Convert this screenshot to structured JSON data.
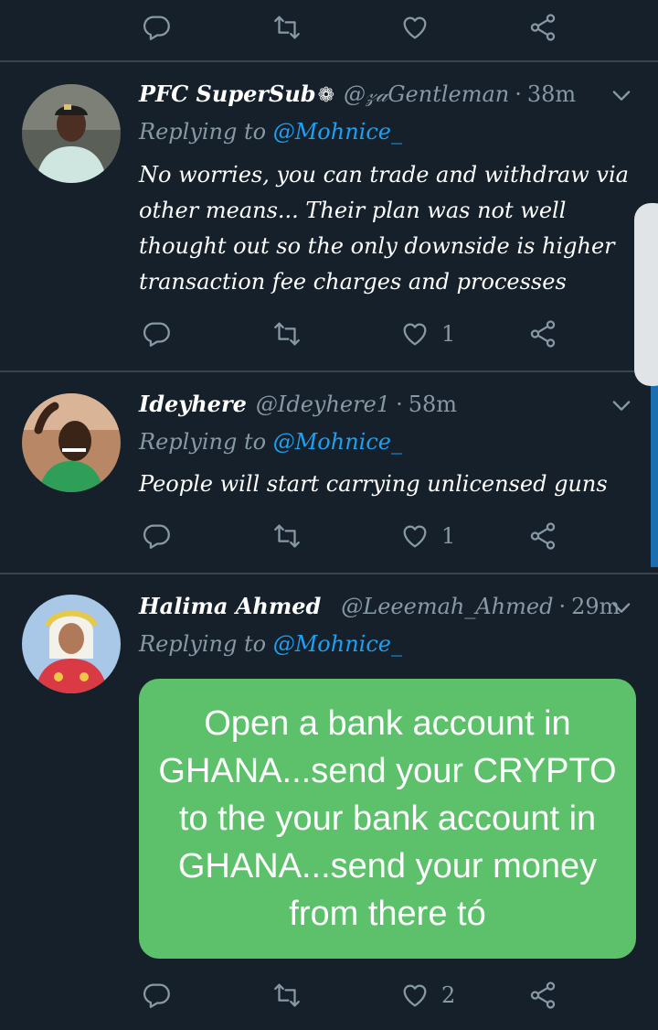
{
  "top_actions": {
    "like_count": ""
  },
  "tweets": [
    {
      "name": "PFC SuperSub",
      "badge": "❁",
      "handle": "@𝓏𝒶Gentleman",
      "time": "38m",
      "replying_prefix": "Replying to",
      "replying_to": "@Mohnice_",
      "text": "No worries, you can trade and withdraw via other means... Their plan was not well thought out so the only downside is higher transaction fee charges and processes",
      "like_count": "1"
    },
    {
      "name": "Ideyhere",
      "handle": "@Ideyhere1",
      "time": "58m",
      "replying_prefix": "Replying to",
      "replying_to": "@Mohnice_",
      "text": "People will start carrying unlicensed guns",
      "like_count": "1"
    },
    {
      "name": "Halima Ahmed",
      "handle": "@Leeemah_Ahmed",
      "time": "29m",
      "replying_prefix": "Replying to",
      "replying_to": "@Mohnice_",
      "media_text": "Open a bank account in GHANA...send your CRYPTO to the your bank account in GHANA...send your money from there tó",
      "like_count": "2"
    }
  ],
  "icons": {
    "reply": "reply-icon",
    "retweet": "retweet-icon",
    "like": "heart-icon",
    "share": "share-icon",
    "menu": "chevron-down-icon"
  },
  "colors": {
    "background": "#15202b",
    "muted": "#8899a6",
    "link": "#1da1f2",
    "divider": "#38444d",
    "media_green": "#5cc16a"
  }
}
